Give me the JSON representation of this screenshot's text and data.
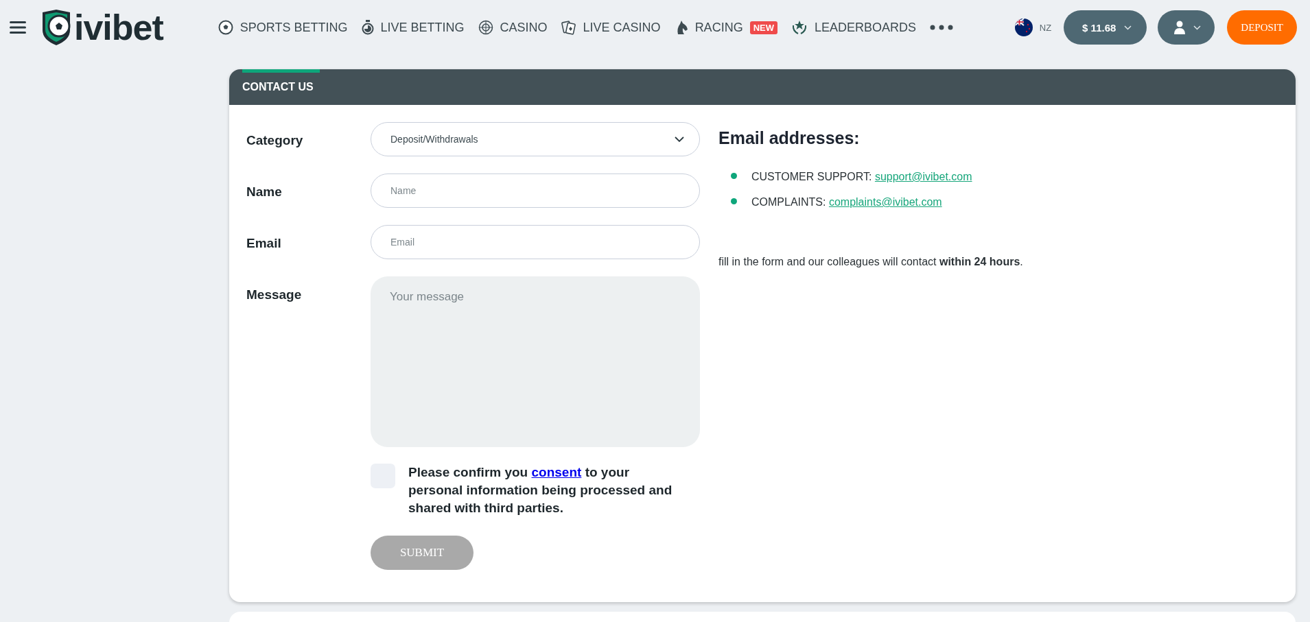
{
  "header": {
    "logo": "ivibet",
    "nav": [
      {
        "label": "SPORTS BETTING"
      },
      {
        "label": "LIVE BETTING"
      },
      {
        "label": "CASINO"
      },
      {
        "label": "LIVE CASINO"
      },
      {
        "label": "RACING",
        "badge": "NEW"
      },
      {
        "label": "LEADERBOARDS"
      }
    ],
    "region": "NZ",
    "balance": "$ 11.68",
    "deposit": "DEPOSIT"
  },
  "card": {
    "title": "CONTACT US",
    "fields": [
      {
        "kind": "select",
        "label": "Category",
        "value": "Deposit/Withdrawals"
      },
      {
        "kind": "input",
        "label": "Name",
        "placeholder": "Name"
      },
      {
        "kind": "input",
        "label": "Email",
        "placeholder": "Email"
      },
      {
        "kind": "textarea",
        "label": "Message",
        "placeholder": "Your message"
      }
    ],
    "consent": {
      "checked": false,
      "before": "Please confirm you",
      "link": "consent",
      "after": "to your personal information being processed and shared with third parties."
    },
    "submit": {
      "label": "SUBMIT",
      "disabled": true
    },
    "info": {
      "title": "Email addresses:",
      "emails": [
        {
          "label": "CUSTOMER SUPPORT:",
          "address": "support@ivibet.com"
        },
        {
          "label": "COMPLAINTS:",
          "address": "complaints@ivibet.com"
        }
      ],
      "note": "fill in the form and our colleagues will contact **within 24 hours**."
    }
  }
}
